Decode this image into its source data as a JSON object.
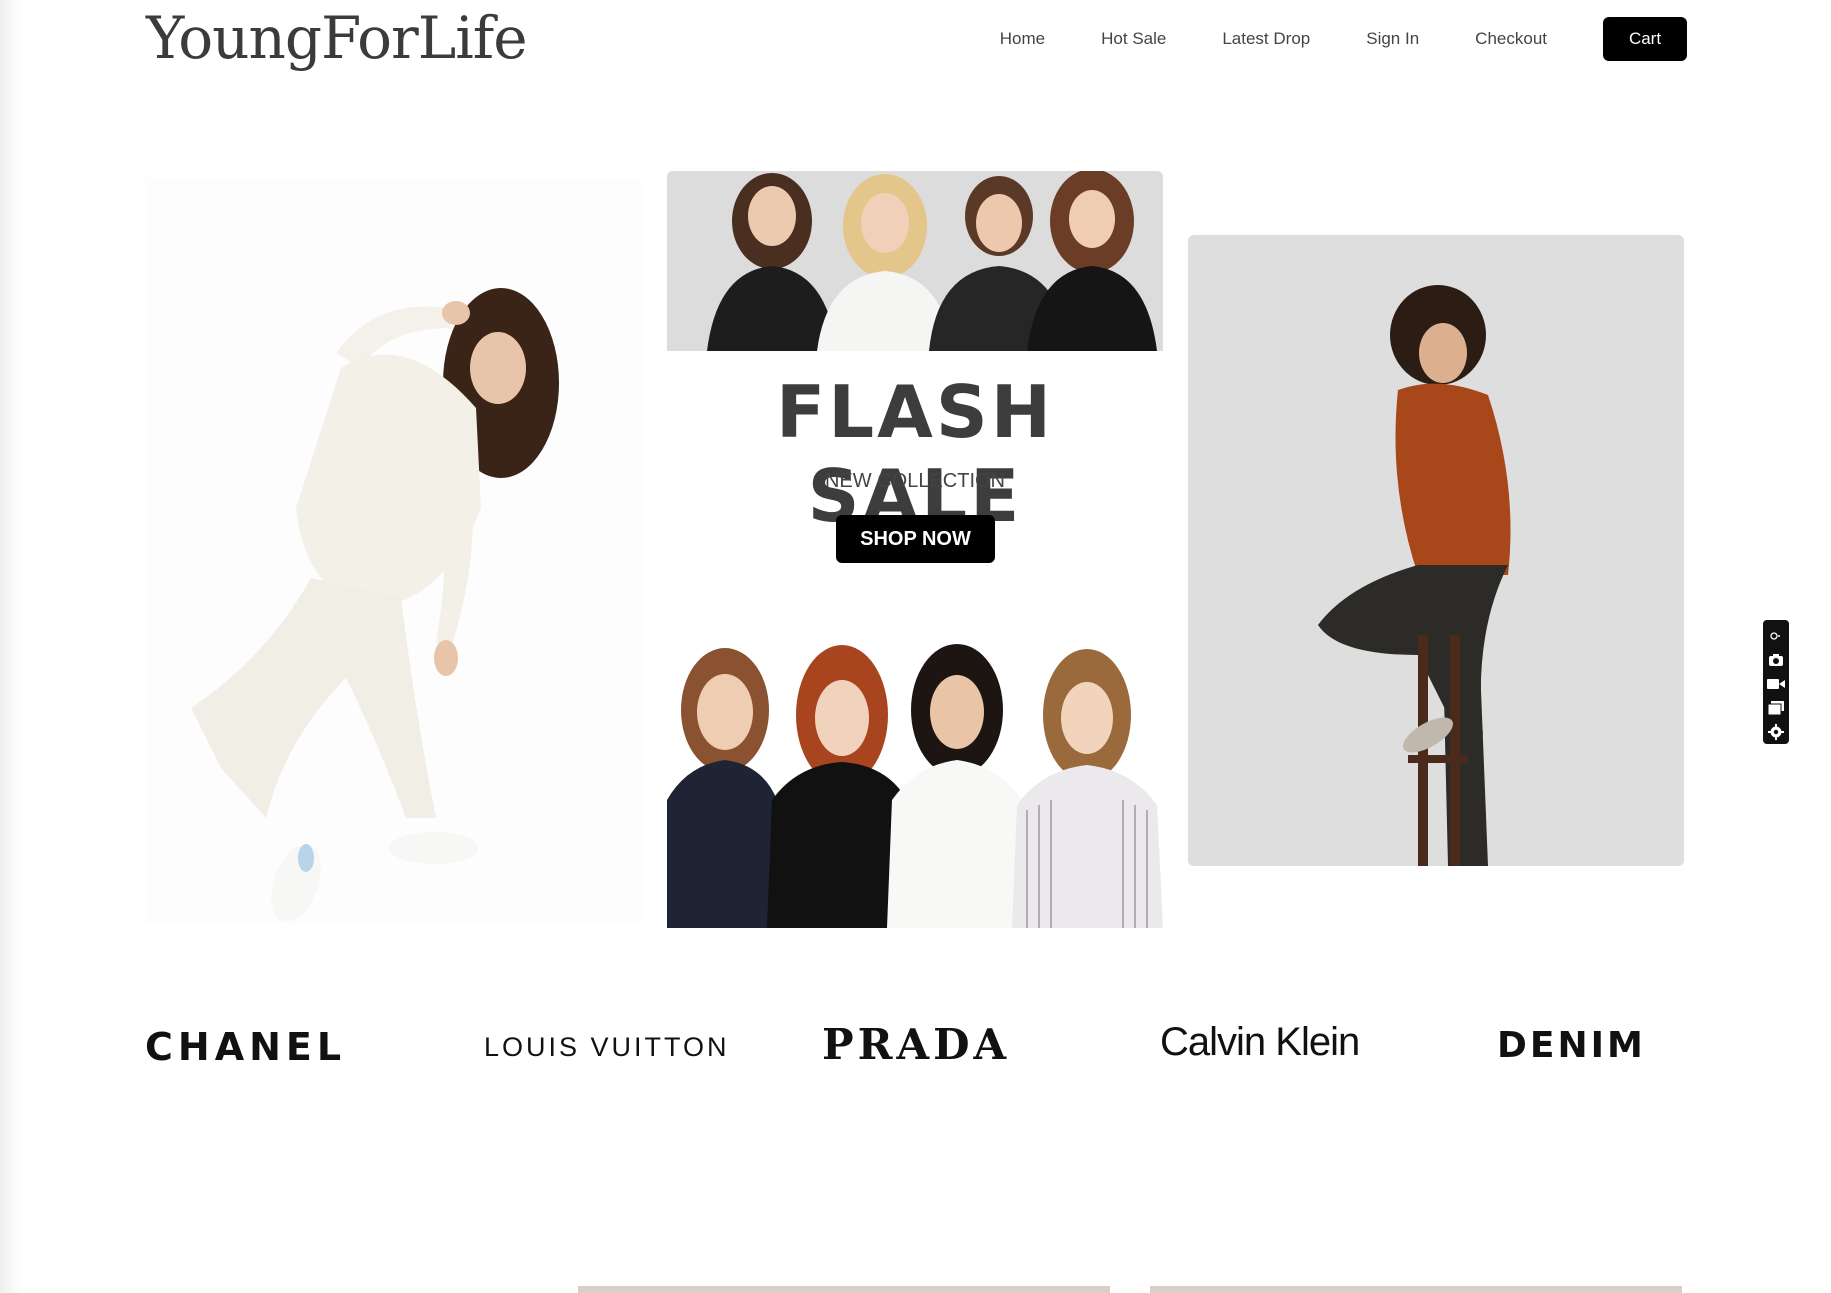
{
  "header": {
    "logo": "YoungForLife",
    "nav": [
      "Home",
      "Hot Sale",
      "Latest Drop",
      "Sign In",
      "Checkout"
    ],
    "cart_label": "Cart"
  },
  "hero": {
    "title": "FLASH SALE",
    "subtitle": "NEW COLLECTION",
    "cta": "SHOP NOW"
  },
  "brands": [
    "CHANEL",
    "LOUIS VUITTON",
    "PRADA",
    "Calvin Klein",
    "DENIM"
  ],
  "colors": {
    "accent": "#000000",
    "text": "#3d3d3d",
    "panel_gray": "#dedede"
  },
  "widget_icons": [
    "link-icon",
    "camera-icon",
    "video-icon",
    "window-icon",
    "gear-icon"
  ]
}
